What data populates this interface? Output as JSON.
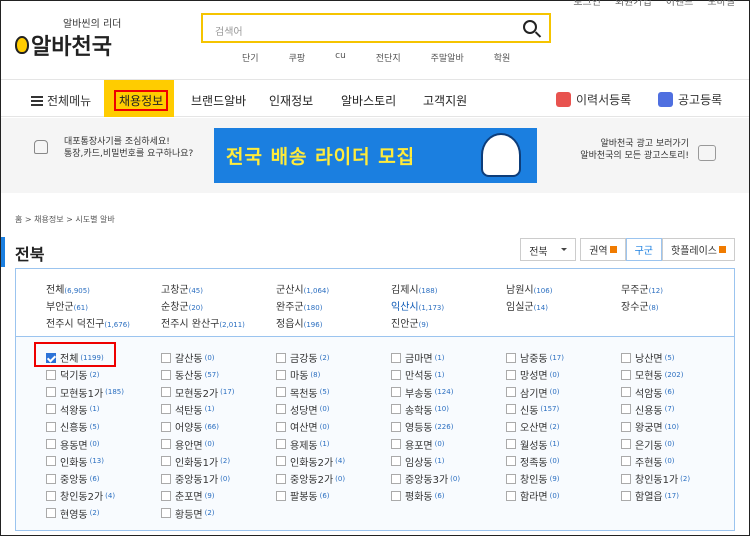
{
  "topbar": [
    "로그인",
    "회원가입",
    "이벤트",
    "모바일"
  ],
  "logo": {
    "tagline": "알바씬의 리더",
    "name": "알바천국"
  },
  "search": {
    "placeholder": "검색어"
  },
  "quick_links": [
    "단기",
    "쿠팡",
    "cu",
    "전단지",
    "주말알바",
    "학원"
  ],
  "nav": {
    "menu": "전체메뉴",
    "active": "채용정보",
    "items": [
      "브랜드알바",
      "인재정보",
      "알바스토리",
      "고객지원"
    ],
    "resume": "이력서등록",
    "post": "공고등록"
  },
  "banner": {
    "left": [
      "대포통장사기를 조심하세요!",
      "통장,카드,비밀번호를 요구하나요?"
    ],
    "headline": "전국 배송 라이더 모집",
    "right": [
      "알바천국 광고 보러가기",
      "알바천국의 모든 광고스토리!"
    ]
  },
  "breadcrumb": "홈 > 채용정보 > 시도별 알바",
  "page_title": "전북",
  "controls": {
    "select": "전북",
    "tabs": [
      "권역",
      "구군",
      "핫플레이스"
    ]
  },
  "regions": [
    {
      "n": "전체",
      "c": "6,905"
    },
    {
      "n": "고창군",
      "c": "45"
    },
    {
      "n": "군산시",
      "c": "1,064"
    },
    {
      "n": "김제시",
      "c": "188"
    },
    {
      "n": "남원시",
      "c": "106"
    },
    {
      "n": "무주군",
      "c": "12"
    },
    {
      "n": "부안군",
      "c": "61"
    },
    {
      "n": "순창군",
      "c": "20"
    },
    {
      "n": "완주군",
      "c": "180"
    },
    {
      "n": "익산시",
      "c": "1,173"
    },
    {
      "n": "임실군",
      "c": "14"
    },
    {
      "n": "장수군",
      "c": "8"
    },
    {
      "n": "전주시 덕진구",
      "c": "1,676"
    },
    {
      "n": "전주시 완산구",
      "c": "2,011"
    },
    {
      "n": "정읍시",
      "c": "196"
    },
    {
      "n": "진안군",
      "c": "9"
    }
  ],
  "dongs": [
    {
      "n": "전체",
      "c": "1199",
      "checked": true
    },
    {
      "n": "갈산동",
      "c": "0"
    },
    {
      "n": "금강동",
      "c": "2"
    },
    {
      "n": "금마면",
      "c": "1"
    },
    {
      "n": "남중동",
      "c": "17"
    },
    {
      "n": "낭산면",
      "c": "5"
    },
    {
      "n": "덕기동",
      "c": "2"
    },
    {
      "n": "동산동",
      "c": "57"
    },
    {
      "n": "마동",
      "c": "8"
    },
    {
      "n": "만석동",
      "c": "1"
    },
    {
      "n": "망성면",
      "c": "0"
    },
    {
      "n": "모현동",
      "c": "202"
    },
    {
      "n": "모현동1가",
      "c": "185"
    },
    {
      "n": "모현동2가",
      "c": "17"
    },
    {
      "n": "목천동",
      "c": "5"
    },
    {
      "n": "부송동",
      "c": "124"
    },
    {
      "n": "삼기면",
      "c": "0"
    },
    {
      "n": "석암동",
      "c": "6"
    },
    {
      "n": "석왕동",
      "c": "1"
    },
    {
      "n": "석탄동",
      "c": "1"
    },
    {
      "n": "성당면",
      "c": "0"
    },
    {
      "n": "송학동",
      "c": "10"
    },
    {
      "n": "신동",
      "c": "157"
    },
    {
      "n": "신용동",
      "c": "7"
    },
    {
      "n": "신흥동",
      "c": "5"
    },
    {
      "n": "어양동",
      "c": "66"
    },
    {
      "n": "여산면",
      "c": "0"
    },
    {
      "n": "영등동",
      "c": "226"
    },
    {
      "n": "오산면",
      "c": "2"
    },
    {
      "n": "왕궁면",
      "c": "10"
    },
    {
      "n": "용동면",
      "c": "0"
    },
    {
      "n": "용안면",
      "c": "0"
    },
    {
      "n": "용제동",
      "c": "1"
    },
    {
      "n": "용포면",
      "c": "0"
    },
    {
      "n": "월성동",
      "c": "1"
    },
    {
      "n": "은기동",
      "c": "0"
    },
    {
      "n": "인화동",
      "c": "13"
    },
    {
      "n": "인화동1가",
      "c": "2"
    },
    {
      "n": "인화동2가",
      "c": "4"
    },
    {
      "n": "임상동",
      "c": "1"
    },
    {
      "n": "정족동",
      "c": "0"
    },
    {
      "n": "주현동",
      "c": "0"
    },
    {
      "n": "중앙동",
      "c": "6"
    },
    {
      "n": "중앙동1가",
      "c": "0"
    },
    {
      "n": "중앙동2가",
      "c": "0"
    },
    {
      "n": "중앙동3가",
      "c": "0"
    },
    {
      "n": "창인동",
      "c": "9"
    },
    {
      "n": "창인동1가",
      "c": "2"
    },
    {
      "n": "창인동2가",
      "c": "4"
    },
    {
      "n": "춘포면",
      "c": "9"
    },
    {
      "n": "팔봉동",
      "c": "6"
    },
    {
      "n": "평화동",
      "c": "6"
    },
    {
      "n": "함라면",
      "c": "0"
    },
    {
      "n": "함열읍",
      "c": "17"
    },
    {
      "n": "현영동",
      "c": "2"
    },
    {
      "n": "황등면",
      "c": "2"
    }
  ]
}
